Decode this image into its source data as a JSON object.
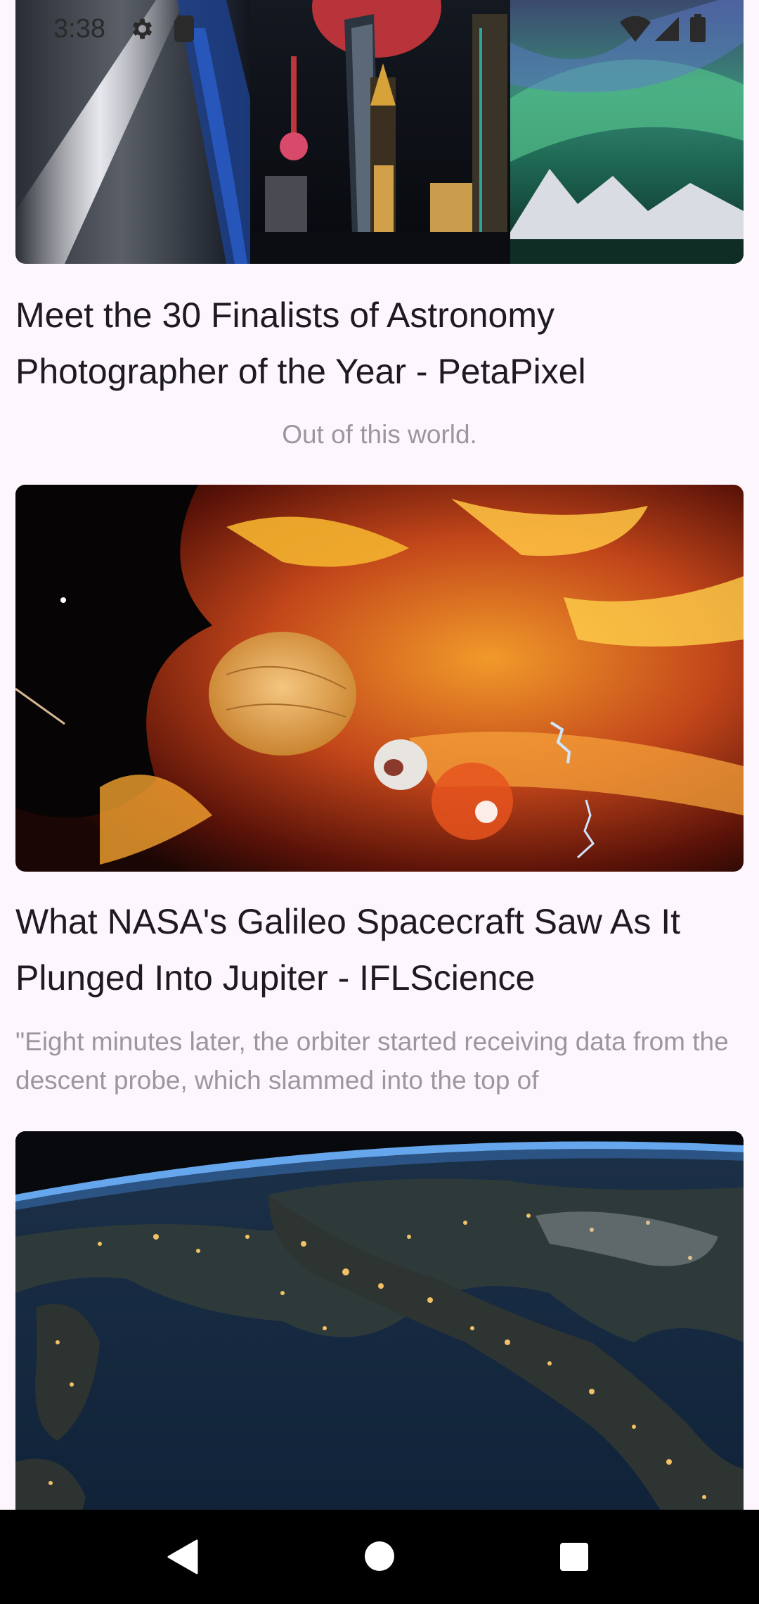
{
  "status_bar": {
    "time": "3:38",
    "icons": [
      "gear-icon",
      "sim-card-icon",
      "wifi-icon",
      "cell-signal-icon",
      "battery-icon"
    ]
  },
  "articles": [
    {
      "title": "Meet the 30 Finalists of Astronomy Photographer of the Year - PetaPixel",
      "description": "Out of this world.",
      "image": "astronomy-photo-collage"
    },
    {
      "title": "What NASA's Galileo Spacecraft Saw As It Plunged Into Jupiter - IFLScience",
      "description": "\"Eight minutes later, the orbiter started receiving data from the descent probe, which slammed into the top of",
      "image": "galileo-probe-illustration"
    },
    {
      "title": "",
      "description": "",
      "image": "earth-night-italy-photo"
    }
  ],
  "nav_bar": {
    "buttons": [
      "back-icon",
      "home-icon",
      "recent-apps-icon"
    ]
  },
  "colors": {
    "background": "#fdf7fd",
    "title_text": "#1d1b20",
    "description_text": "#9a979d",
    "nav_background": "#000000"
  }
}
